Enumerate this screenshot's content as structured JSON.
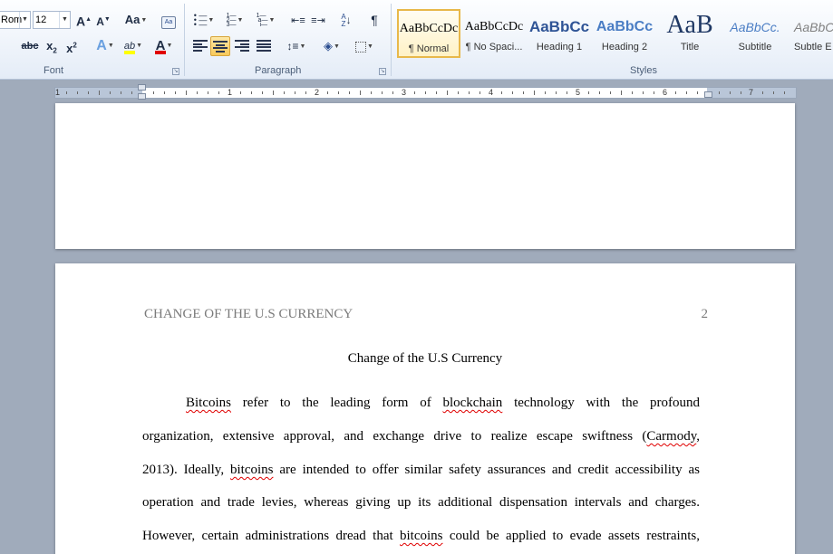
{
  "ribbon": {
    "font_group": {
      "label": "Font",
      "font_name": "Rom",
      "font_size": "12",
      "grow_font_label": "A",
      "shrink_font_label": "A",
      "change_case_label": "Aa",
      "strikethrough_label": "abc",
      "subscript_label": "x",
      "subscript_sub": "2",
      "superscript_label": "x",
      "superscript_sup": "2",
      "text_effects_label": "A",
      "highlight_label": "ab",
      "font_color_label": "A",
      "highlight_color": "#ffff00",
      "font_color": "#e00000"
    },
    "paragraph_group": {
      "label": "Paragraph",
      "sort_label": "A",
      "sort_label_2": "Z",
      "show_marks_label": "¶"
    },
    "styles_group": {
      "label": "Styles",
      "styles": [
        {
          "sample": "AaBbCcDc",
          "name": "¶ Normal"
        },
        {
          "sample": "AaBbCcDc",
          "name": "¶ No Spaci..."
        },
        {
          "sample": "AaBbCc",
          "name": "Heading 1"
        },
        {
          "sample": "AaBbCc",
          "name": "Heading 2"
        },
        {
          "sample": "AaB",
          "name": "Title"
        },
        {
          "sample": "AaBbCc.",
          "name": "Subtitle"
        },
        {
          "sample": "AaBbCc",
          "name": "Subtle E"
        }
      ]
    }
  },
  "ruler": {
    "numbers": [
      "1",
      "1",
      "2",
      "3",
      "4",
      "5",
      "6",
      "7"
    ]
  },
  "document": {
    "running_head": "CHANGE OF THE U.S CURRENCY",
    "page_number": "2",
    "title": "Change of the U.S Currency",
    "lines": [
      [
        {
          "t": "Bitcoins",
          "s": true
        },
        {
          "t": " refer to the leading form of "
        },
        {
          "t": "blockchain",
          "s": true
        },
        {
          "t": " technology with the profound"
        }
      ],
      [
        {
          "t": "organization, extensive approval, and exchange drive to realize escape swiftness ("
        },
        {
          "t": "Carmody",
          "s": true
        },
        {
          "t": ","
        }
      ],
      [
        {
          "t": "2013). Ideally, "
        },
        {
          "t": "bitcoins",
          "s": true
        },
        {
          "t": " are intended to offer similar safety assurances and credit accessibility as"
        }
      ],
      [
        {
          "t": "operation and trade levies, whereas giving up its additional dispensation intervals and charges."
        }
      ],
      [
        {
          "t": "However, certain administrations dread that "
        },
        {
          "t": "bitcoins",
          "s": true
        },
        {
          "t": " could be applied to evade assets restraints,"
        }
      ]
    ]
  }
}
